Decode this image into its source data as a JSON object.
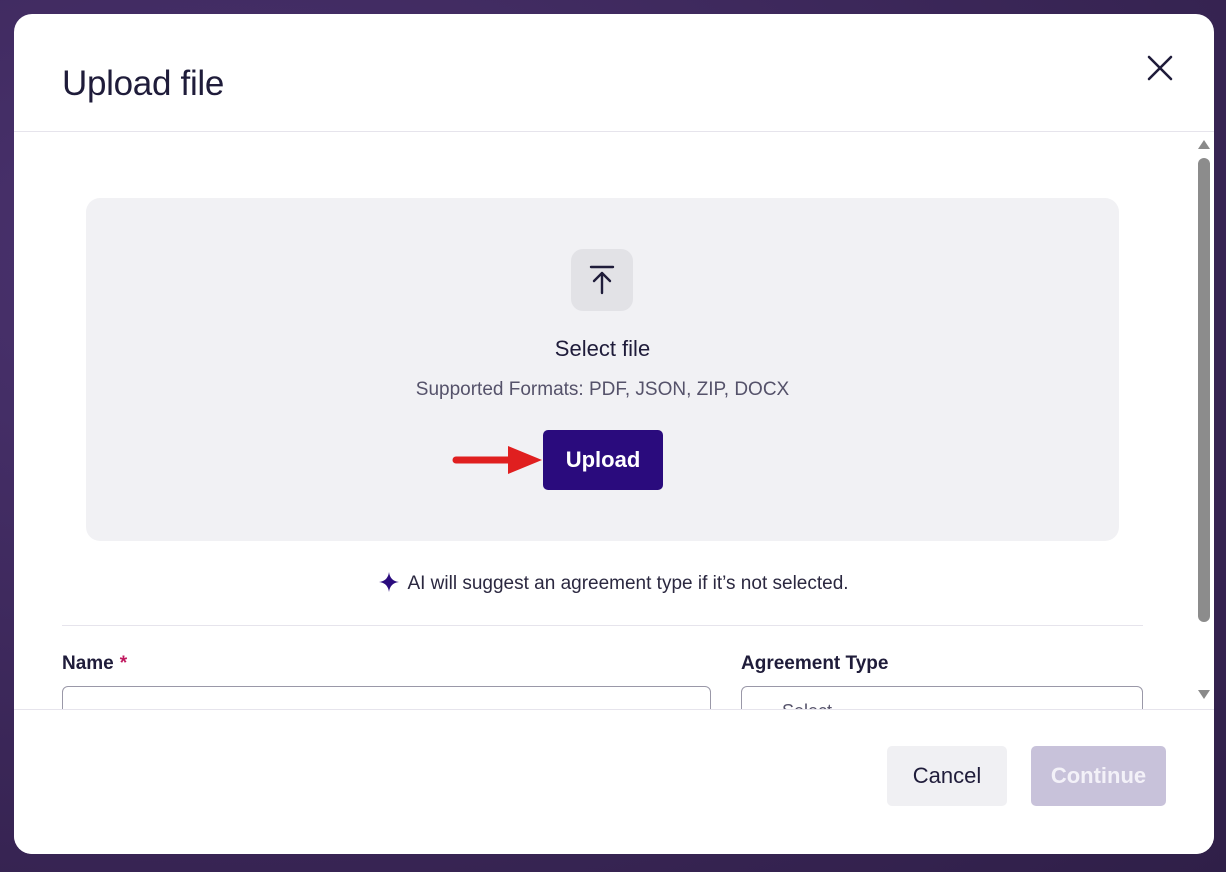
{
  "modal": {
    "title": "Upload file",
    "close_icon": "close-icon"
  },
  "dropzone": {
    "icon": "upload-icon",
    "title": "Select file",
    "formats": "Supported Formats: PDF, JSON, ZIP, DOCX",
    "upload_label": "Upload",
    "annotation_arrow_color": "#e01f1f"
  },
  "ai_hint": {
    "icon": "sparkle-icon",
    "text": "AI will suggest an agreement type if it’s not selected."
  },
  "form": {
    "name_label": "Name",
    "name_required_mark": "*",
    "name_value": "",
    "agreement_type_label": "Agreement Type",
    "agreement_type_value": "Select"
  },
  "footer": {
    "cancel_label": "Cancel",
    "continue_label": "Continue"
  },
  "colors": {
    "primary": "#2a0b7d",
    "disabled": "#c8c2da",
    "required": "#c0185e",
    "backdrop": "#3f2a5e"
  }
}
